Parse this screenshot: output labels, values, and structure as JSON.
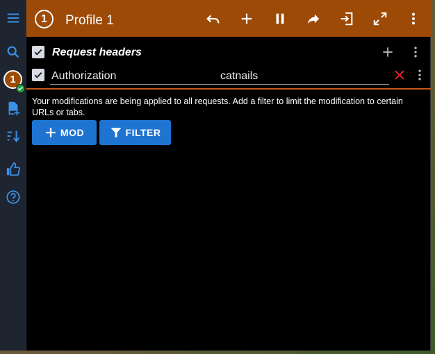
{
  "header": {
    "profile_number": "1",
    "title": "Profile 1"
  },
  "sidebar": {
    "profile_badge": "1",
    "icons": [
      "menu-icon",
      "search-icon",
      "profile-badge",
      "add-file-icon",
      "sort-icon",
      "thumbs-up-icon",
      "help-icon"
    ]
  },
  "section": {
    "title": "Request headers"
  },
  "header_row": {
    "name": "Authorization",
    "value": "catnails"
  },
  "info": {
    "text": "Your modifications are being applied to all requests. Add a filter to limit the modification to certain URLs or tabs."
  },
  "buttons": {
    "mod_label": "MOD",
    "filter_label": "FILTER"
  },
  "colors": {
    "accent": "#9c4a06",
    "button": "#1f74d2",
    "sidebar_icons": "#3b8fe6",
    "delete": "#e02020",
    "check": "#22a040"
  }
}
